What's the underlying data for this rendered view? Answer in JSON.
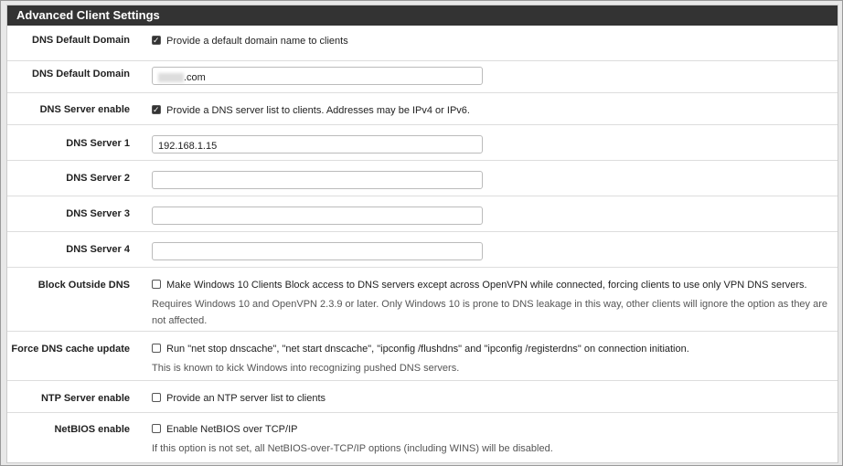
{
  "title": "Advanced Client Settings",
  "rows": [
    {
      "label": "DNS Default Domain",
      "checkbox": true,
      "checked": true,
      "text": "Provide a default domain name to clients"
    },
    {
      "label": "DNS Default Domain",
      "input": ".com"
    },
    {
      "label": "DNS Server enable",
      "checked": true,
      "text": "Provide a DNS server list to clients. Addresses may be IPv4 or IPv6."
    },
    {
      "label": "DNS Server 1",
      "input": "192.168.1.15"
    },
    {
      "label": "DNS Server 2",
      "input": ""
    },
    {
      "label": "DNS Server 3",
      "input": ""
    },
    {
      "label": "DNS Server 4",
      "input": ""
    },
    {
      "label": "Block Outside DNS",
      "checked": false,
      "text": "Make Windows 10 Clients Block access to DNS servers except across OpenVPN while connected, forcing clients to use only VPN DNS servers.",
      "help": "Requires Windows 10 and OpenVPN 2.3.9 or later. Only Windows 10 is prone to DNS leakage in this way, other clients will ignore the option as they are not affected."
    },
    {
      "label": "Force DNS cache update",
      "checked": false,
      "text": "Run \"net stop dnscache\", \"net start dnscache\", \"ipconfig /flushdns\" and \"ipconfig /registerdns\" on connection initiation.",
      "help": "This is known to kick Windows into recognizing pushed DNS servers."
    },
    {
      "label": "NTP Server enable",
      "checked": false,
      "text": "Provide an NTP server list to clients"
    },
    {
      "label": "NetBIOS enable",
      "checked": false,
      "text": "Enable NetBIOS over TCP/IP",
      "help": "If this option is not set, all NetBIOS-over-TCP/IP options (including WINS) will be disabled."
    }
  ]
}
